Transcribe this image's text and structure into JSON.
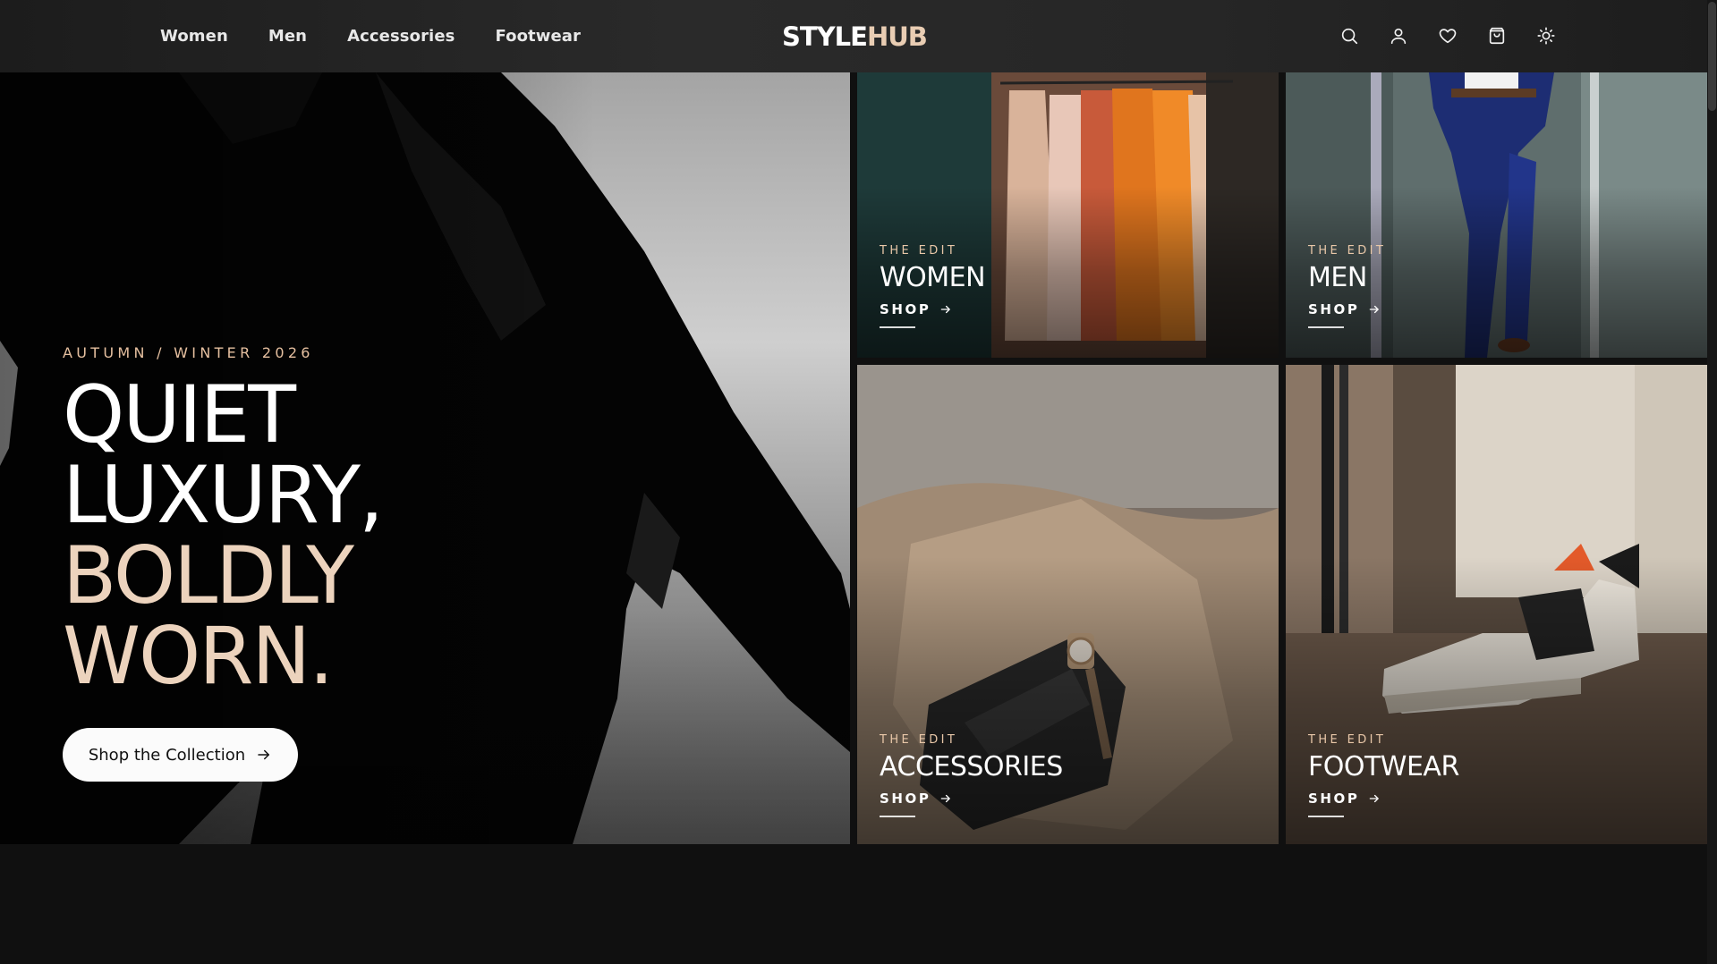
{
  "brand": {
    "part1": "STYLE",
    "part2": "HUB"
  },
  "nav": [
    {
      "label": "Women"
    },
    {
      "label": "Men"
    },
    {
      "label": "Accessories"
    },
    {
      "label": "Footwear"
    }
  ],
  "header_icons": [
    "search-icon",
    "user-icon",
    "heart-icon",
    "shopping-bag-icon",
    "sun-icon"
  ],
  "hero": {
    "eyebrow": "AUTUMN / WINTER 2026",
    "headline_lines": [
      "QUIET",
      "LUXURY,",
      "BOLDLY",
      "WORN."
    ],
    "cta_label": "Shop the Collection"
  },
  "tiles": [
    {
      "kicker": "THE EDIT",
      "name": "WOMEN",
      "cta": "SHOP"
    },
    {
      "kicker": "THE EDIT",
      "name": "MEN",
      "cta": "SHOP"
    },
    {
      "kicker": "THE EDIT",
      "name": "ACCESSORIES",
      "cta": "SHOP"
    },
    {
      "kicker": "THE EDIT",
      "name": "FOOTWEAR",
      "cta": "SHOP"
    }
  ],
  "colors": {
    "background": "#101010",
    "accent": "#ecd3bd",
    "eyebrow": "#e6c0a0",
    "header": "#262626"
  }
}
